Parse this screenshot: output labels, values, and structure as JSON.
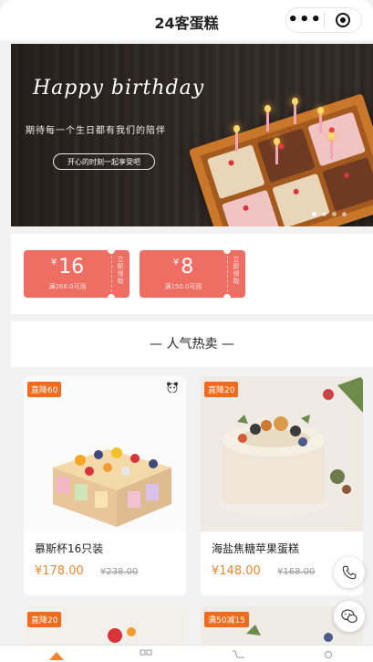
{
  "header": {
    "title": "24客蛋糕",
    "more_glyph": "•••"
  },
  "banner": {
    "title": "Happy birthday",
    "subtitle": "期待每一个生日都有我们的陪伴",
    "button": "开心的时刻一起享受吧",
    "slides": 4,
    "active_slide": 1
  },
  "coupons": [
    {
      "currency": "¥",
      "amount": "16",
      "condition": "满268.0可用",
      "claim": "立即领取"
    },
    {
      "currency": "¥",
      "amount": "8",
      "condition": "满150.0可用",
      "claim": "立即领取"
    }
  ],
  "section": {
    "title": "— 人气热卖 —"
  },
  "products": [
    {
      "tag": "直降60",
      "name": "慕斯杯16只装",
      "price": "¥178.00",
      "old_price": "¥238.00"
    },
    {
      "tag": "直降20",
      "name": "海盐焦糖苹果蛋糕",
      "price": "¥148.00",
      "old_price": "¥168.00"
    },
    {
      "tag": "直降20"
    },
    {
      "tag": "满50减15"
    }
  ],
  "icons": {
    "phone": "phone-icon",
    "service": "customer-service-icon",
    "home": "home-icon",
    "category": "category-icon",
    "cart": "cart-icon",
    "user": "user-icon",
    "panda": "panda-icon"
  },
  "colors": {
    "accent": "#f0852c",
    "coupon": "#ee6e64",
    "tag": "#f26b1d"
  }
}
